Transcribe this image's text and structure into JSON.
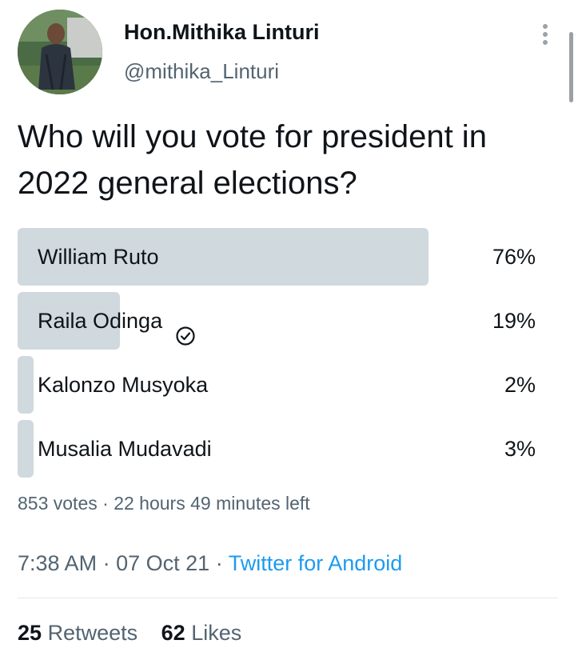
{
  "tweet": {
    "author_name": "Hon.Mithika Linturi",
    "author_handle": "@mithika_Linturi",
    "question": "Who will you vote for president in 2022 general elections?"
  },
  "poll": {
    "options": [
      {
        "label": "William Ruto",
        "percent_text": "76%",
        "percent": 76,
        "selected": false
      },
      {
        "label": "Raila Odinga",
        "percent_text": "19%",
        "percent": 19,
        "selected": true
      },
      {
        "label": "Kalonzo Musyoka",
        "percent_text": "2%",
        "percent": 2,
        "selected": false
      },
      {
        "label": "Musalia Mudavadi",
        "percent_text": "3%",
        "percent": 3,
        "selected": false
      }
    ],
    "votes": "853 votes",
    "separator": "·",
    "time_left": "22 hours 49 minutes left"
  },
  "meta": {
    "time": "7:38 AM",
    "dot": "·",
    "date": "07 Oct 21",
    "source": "Twitter for Android"
  },
  "stats": {
    "retweets_count": "25",
    "retweets_label": "Retweets",
    "likes_count": "62",
    "likes_label": "Likes"
  },
  "icons": {
    "more": "more-vertical-icon",
    "selected": "check-circle-icon"
  },
  "colors": {
    "text": "#0f1419",
    "secondary": "#536471",
    "link": "#1d9bf0",
    "poll_bar": "#cfd9de"
  }
}
